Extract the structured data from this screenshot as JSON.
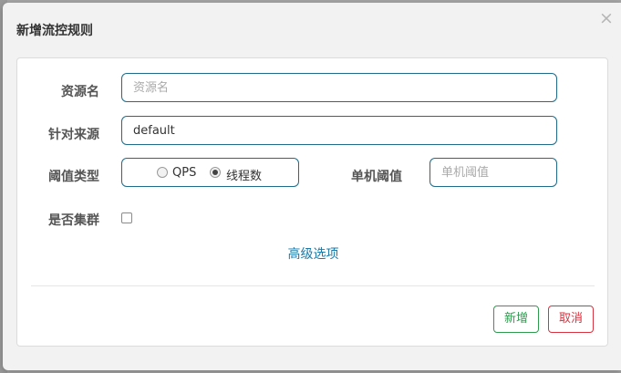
{
  "dialog": {
    "title": "新增流控规则",
    "close_glyph": "×"
  },
  "form": {
    "resource": {
      "label": "资源名",
      "value": "",
      "placeholder": "资源名"
    },
    "source": {
      "label": "针对来源",
      "value": "default",
      "placeholder": ""
    },
    "threshold_type": {
      "label": "阈值类型",
      "options": [
        {
          "label": "QPS",
          "checked": false
        },
        {
          "label": "线程数",
          "checked": true
        }
      ]
    },
    "single_threshold": {
      "label": "单机阈值",
      "value": "",
      "placeholder": "单机阈值"
    },
    "cluster": {
      "label": "是否集群",
      "checked": false
    },
    "advanced_link": "高级选项"
  },
  "buttons": {
    "add_label": "新增",
    "cancel_label": "取消"
  },
  "colors": {
    "input_border": "#1d6c8c",
    "link": "#1d7aa8",
    "add_button": "#2e9b4e",
    "cancel_button": "#d9333f"
  }
}
